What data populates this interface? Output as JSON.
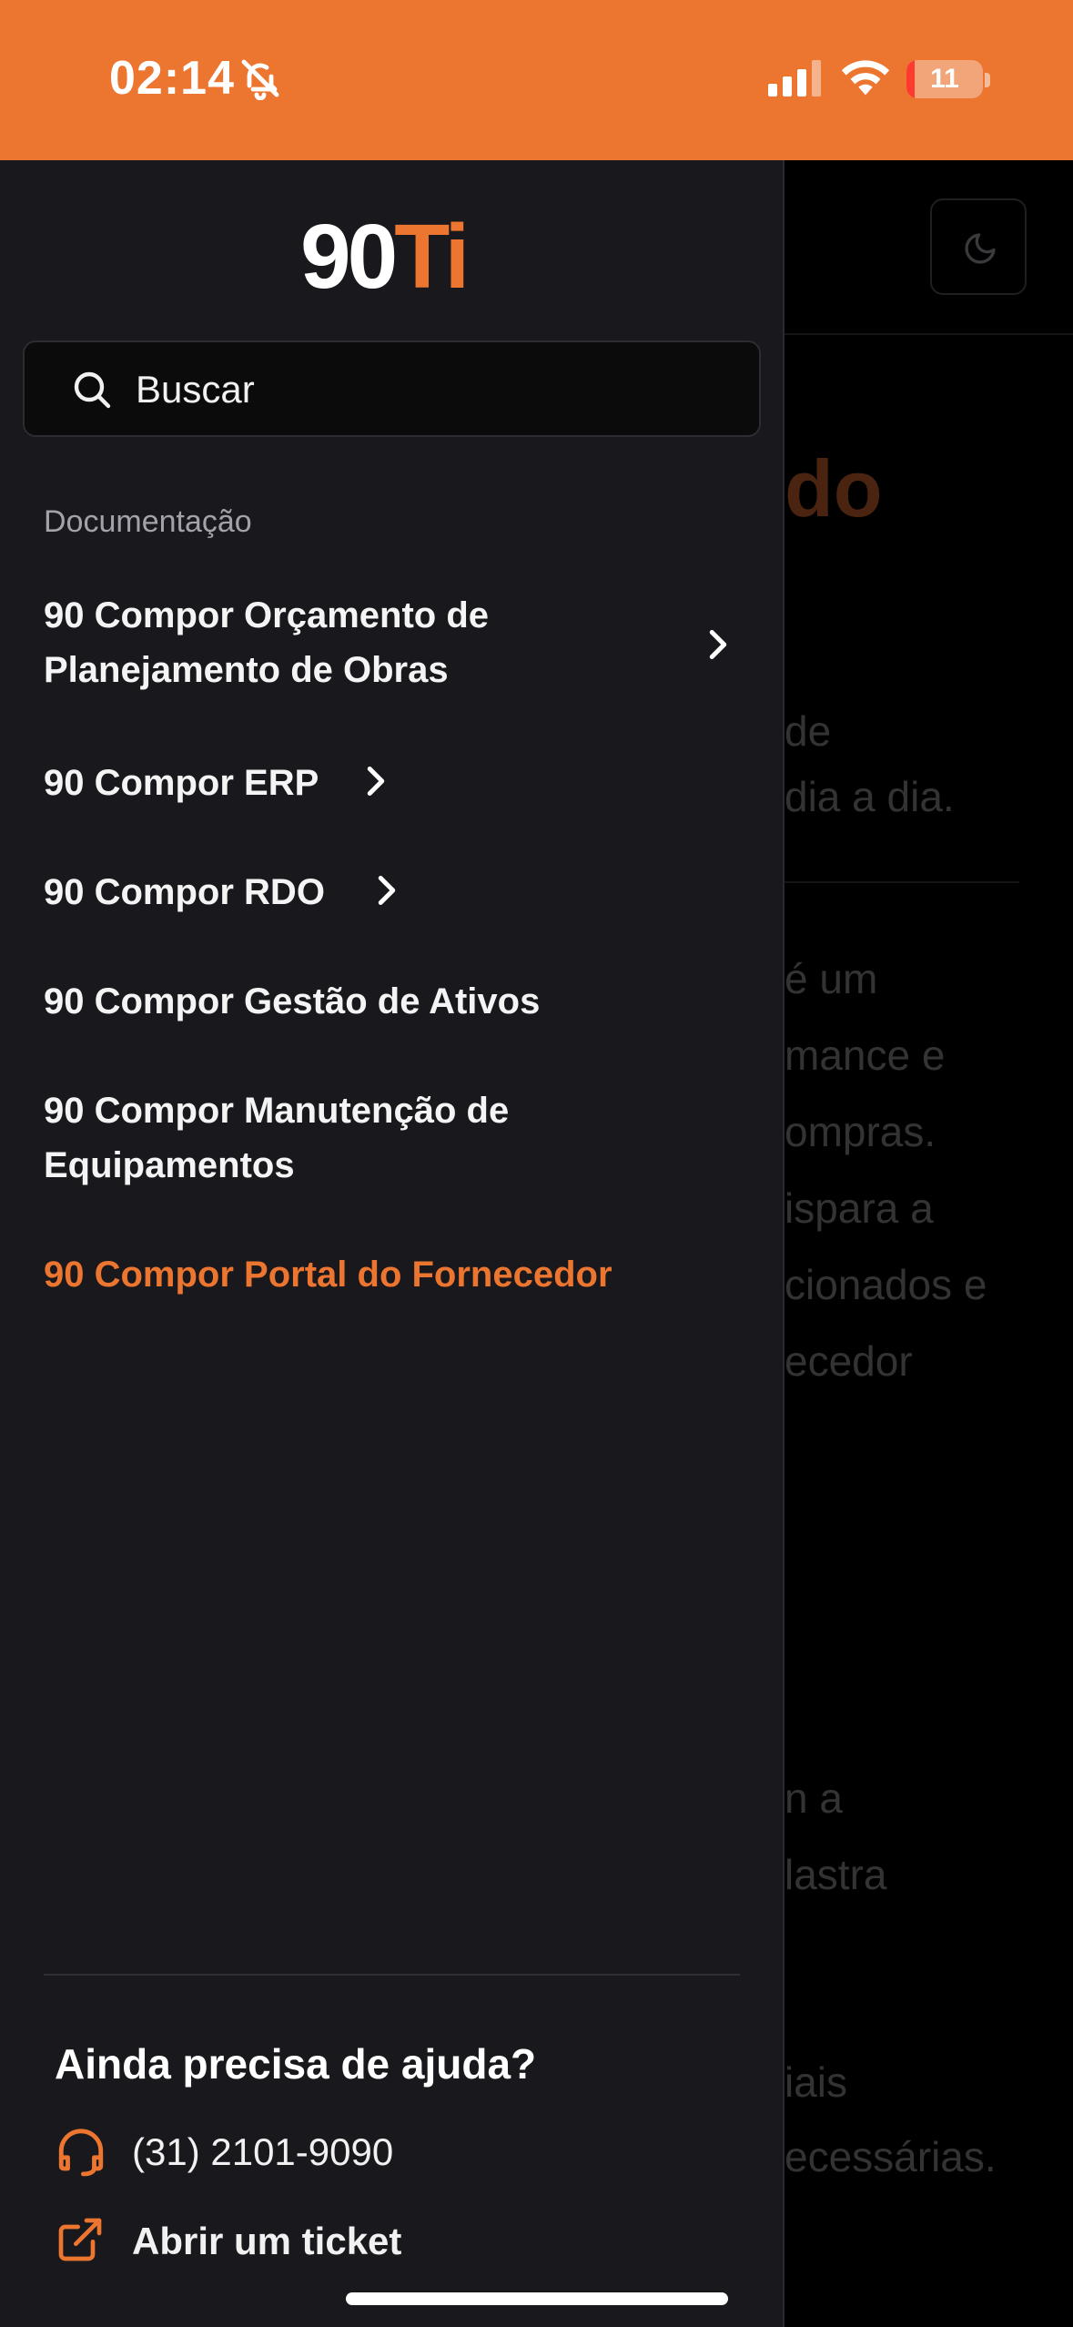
{
  "status_bar": {
    "time": "02:14",
    "battery_level": "11",
    "battery_fraction": 0.11,
    "colors": {
      "background": "#ec7630"
    }
  },
  "background_page": {
    "title_fragment": "do",
    "lines": [
      "de",
      "dia a dia.",
      "é um",
      "mance e",
      "ompras.",
      "ispara a",
      "cionados e",
      "ecedor",
      "n a",
      "lastra",
      "iais",
      "ecessárias."
    ]
  },
  "drawer": {
    "logo": {
      "main": "90",
      "accent": "Ti"
    },
    "search": {
      "placeholder": "Buscar"
    },
    "section_title": "Documentação",
    "nav_items": [
      {
        "line1": "90 Compor Orçamento de",
        "line2": "Planejamento de Obras",
        "has_children": true
      },
      {
        "label": "90 Compor ERP",
        "has_children": true
      },
      {
        "label": "90 Compor RDO",
        "has_children": true
      },
      {
        "label": "90 Compor Gestão de Ativos",
        "has_children": false
      },
      {
        "line1": "90 Compor Manutenção de",
        "line2": "Equipamentos",
        "has_children": false
      },
      {
        "label": "90 Compor Portal do Fornecedor",
        "has_children": false,
        "active": true
      }
    ],
    "help": {
      "title": "Ainda precisa de ajuda?",
      "phone": "(31) 2101-9090",
      "ticket": "Abrir um ticket"
    }
  },
  "icons": [
    "bell-slash-icon",
    "cellular-signal-icon",
    "wifi-icon",
    "battery-icon",
    "moon-icon",
    "search-icon",
    "chevron-right-icon",
    "headset-icon",
    "external-link-icon"
  ],
  "colors": {
    "accent": "#ec7630",
    "drawer_bg": "#19181d",
    "text": "#f4f4f5"
  }
}
